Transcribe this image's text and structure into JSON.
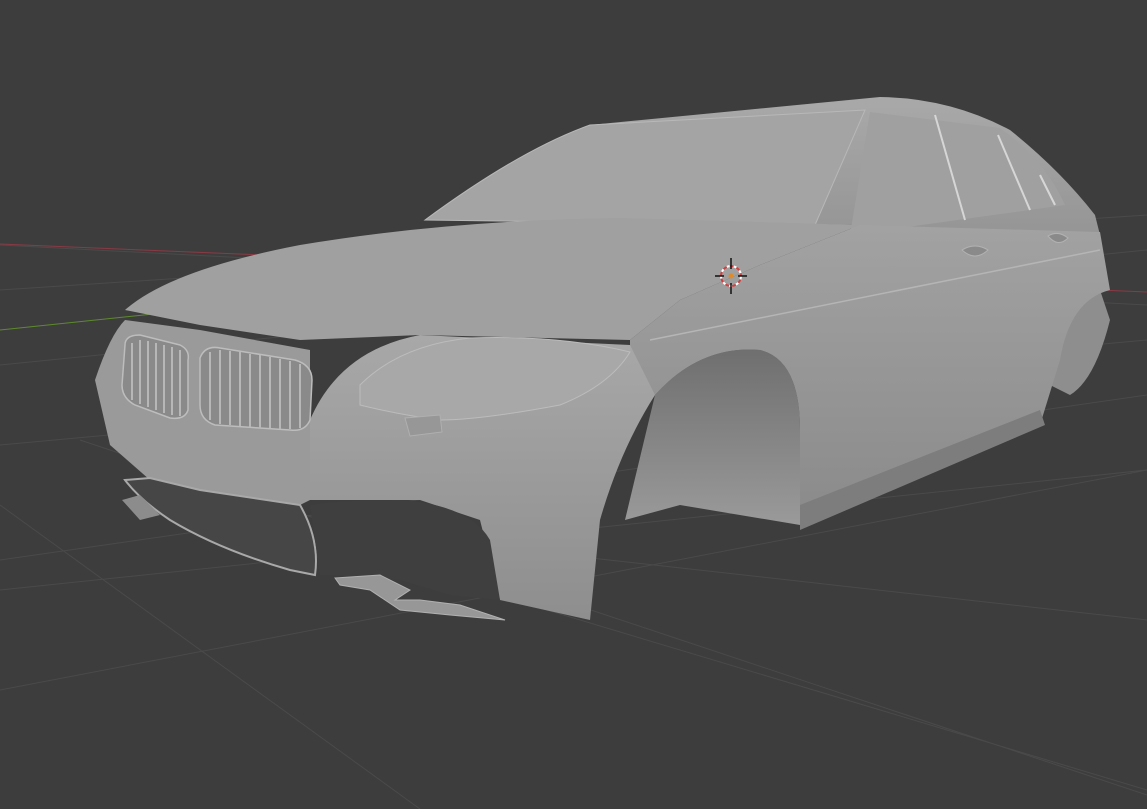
{
  "viewport": {
    "background_color": "#3d3d3d",
    "grid_color": "#4a4a4a",
    "x_axis_color": "#8a3a45",
    "y_axis_color": "#5e8a2e",
    "mesh_color": "#9b9b9b",
    "mesh_highlight_color": "#b0b0b0",
    "mesh_shadow_color": "#6e6e6e",
    "cursor_ring_color": "#d04040"
  },
  "scene": {
    "object_icon": "car-body-mesh-icon",
    "cursor_icon": "3d-cursor-icon"
  }
}
